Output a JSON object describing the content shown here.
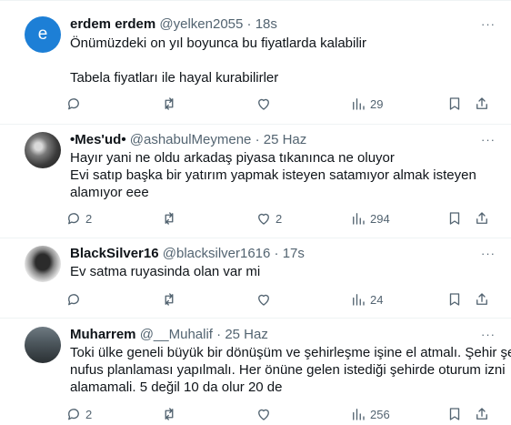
{
  "tweets": [
    {
      "avatar_letter": "e",
      "name": "erdem erdem",
      "handle": "@yelken2055",
      "dot": "·",
      "time": "18s",
      "lines": [
        "Önümüzdeki on yıl boyunca bu fiyatlarda kalabilir",
        "",
        "Tabela fiyatları ile hayal kurabilirler"
      ],
      "replies": "",
      "retweets": "",
      "likes": "",
      "views": "29"
    },
    {
      "avatar_letter": "",
      "name": "•Mes'ud•",
      "handle": "@ashabulMeymene",
      "dot": "·",
      "time": "25 Haz",
      "lines": [
        "Hayır yani ne oldu arkadaş piyasa tıkanınca ne oluyor",
        "Evi satıp başka bir yatırım yapmak isteyen satamıyor almak isteyen",
        "alamıyor eee"
      ],
      "replies": "2",
      "retweets": "",
      "likes": "2",
      "views": "294"
    },
    {
      "avatar_letter": "",
      "name": "BlackSilver16",
      "handle": "@blacksilver1616",
      "dot": "·",
      "time": "17s",
      "lines": [
        "Ev satma ruyasinda olan var mi"
      ],
      "replies": "",
      "retweets": "",
      "likes": "",
      "views": "24"
    },
    {
      "avatar_letter": "",
      "name": "Muharrem",
      "handle": "@__Muhalif",
      "dot": "·",
      "time": "25 Haz",
      "lines": [
        "Toki ülke geneli büyük bir dönüşüm ve şehirleşme işine el atmalı. Şehir şehir",
        "nufus planlaması yapılmalı. Her önüne gelen istediği şehirde oturum izni",
        "alamamali. 5 değil 10 da olur  20 de"
      ],
      "replies": "2",
      "retweets": "",
      "likes": "",
      "views": "256"
    }
  ],
  "more_glyph": "···",
  "icons": [
    "reply-icon",
    "retweet-icon",
    "like-icon",
    "views-icon",
    "bookmark-icon",
    "share-icon",
    "more-icon"
  ],
  "colors": {
    "text": "#0f1419",
    "secondary": "#536471",
    "divider": "#eff3f4",
    "avatar_blue": "#1d7fd6"
  }
}
